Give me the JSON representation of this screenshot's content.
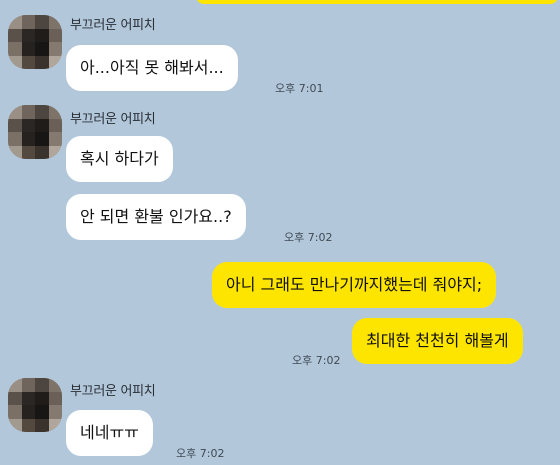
{
  "chat": {
    "messages": [
      {
        "sender": "부끄러운 어피치",
        "text": "아...아직 못 해봐서...",
        "time": "오후 7:01"
      },
      {
        "sender": "부끄러운 어피치",
        "text": "혹시 하다가"
      },
      {
        "text": "안 되면 환불 인가요..?",
        "time": "오후 7:02"
      },
      {
        "text": "아니 그래도 만나기까지했는데 줘야지;"
      },
      {
        "text": "최대한 천천히 해볼게",
        "time": "오후 7:02"
      },
      {
        "sender": "부끄러운 어피치",
        "text": "네네ㅠㅠ",
        "time": "오후 7:02"
      }
    ]
  },
  "colors": {
    "background": "#b2c7da",
    "incoming_bubble": "#ffffff",
    "outgoing_bubble": "#fee500"
  },
  "icons": {
    "avatar": "pixelated-profile-avatar"
  }
}
